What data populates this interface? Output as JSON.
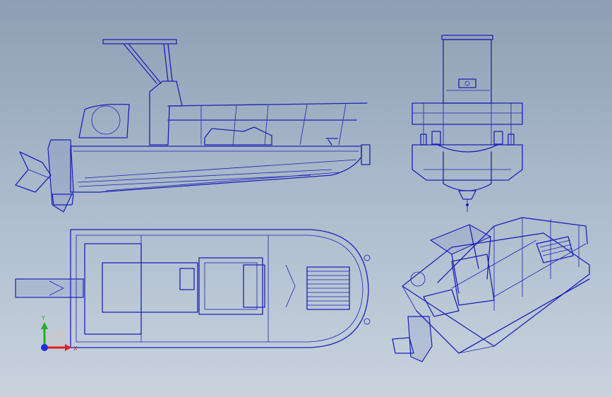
{
  "drawing": {
    "views": [
      "side-view",
      "front-view",
      "top-view",
      "isometric-view"
    ]
  },
  "triad": {
    "x_label": "X",
    "y_label": "Y",
    "x_color": "#e02020",
    "y_color": "#20b020",
    "z_color": "#2030e0"
  },
  "colors": {
    "line": "#1a22b8",
    "background_top": "#8e9fb5",
    "background_bottom": "#c9d3de"
  }
}
